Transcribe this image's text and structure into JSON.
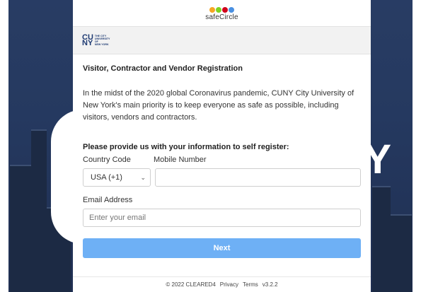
{
  "brand": {
    "safecircle_text": "safeCircle",
    "dot_colors": [
      "#f5a623",
      "#7ed321",
      "#d0021b",
      "#4a90e2"
    ]
  },
  "cuny": {
    "mark_top": "CU",
    "mark_bottom": "NY",
    "small_lines": [
      "THE CITY",
      "UNIVERSITY",
      "OF",
      "NEW YORK"
    ]
  },
  "form": {
    "heading": "Visitor, Contractor and Vendor Registration",
    "intro": "In the midst of the 2020 global Coronavirus pandemic, CUNY City University of New York's main priority is to keep everyone as safe as possible, including visitors, vendors and contractors.",
    "subheading": "Please provide us with your information to self register:",
    "country_code_label": "Country Code",
    "country_code_value": "USA (+1)",
    "mobile_label": "Mobile Number",
    "mobile_value": "",
    "email_label": "Email Address",
    "email_placeholder": "Enter your email",
    "next_label": "Next"
  },
  "footer": {
    "copyright": "© 2022 CLEARED4",
    "privacy": "Privacy",
    "terms": "Terms",
    "version": "v3.2.2"
  },
  "background": {
    "overlay_letter": "Y"
  },
  "colors": {
    "accent_button": "#6eb0f5",
    "cuny_blue": "#1f3b73"
  }
}
